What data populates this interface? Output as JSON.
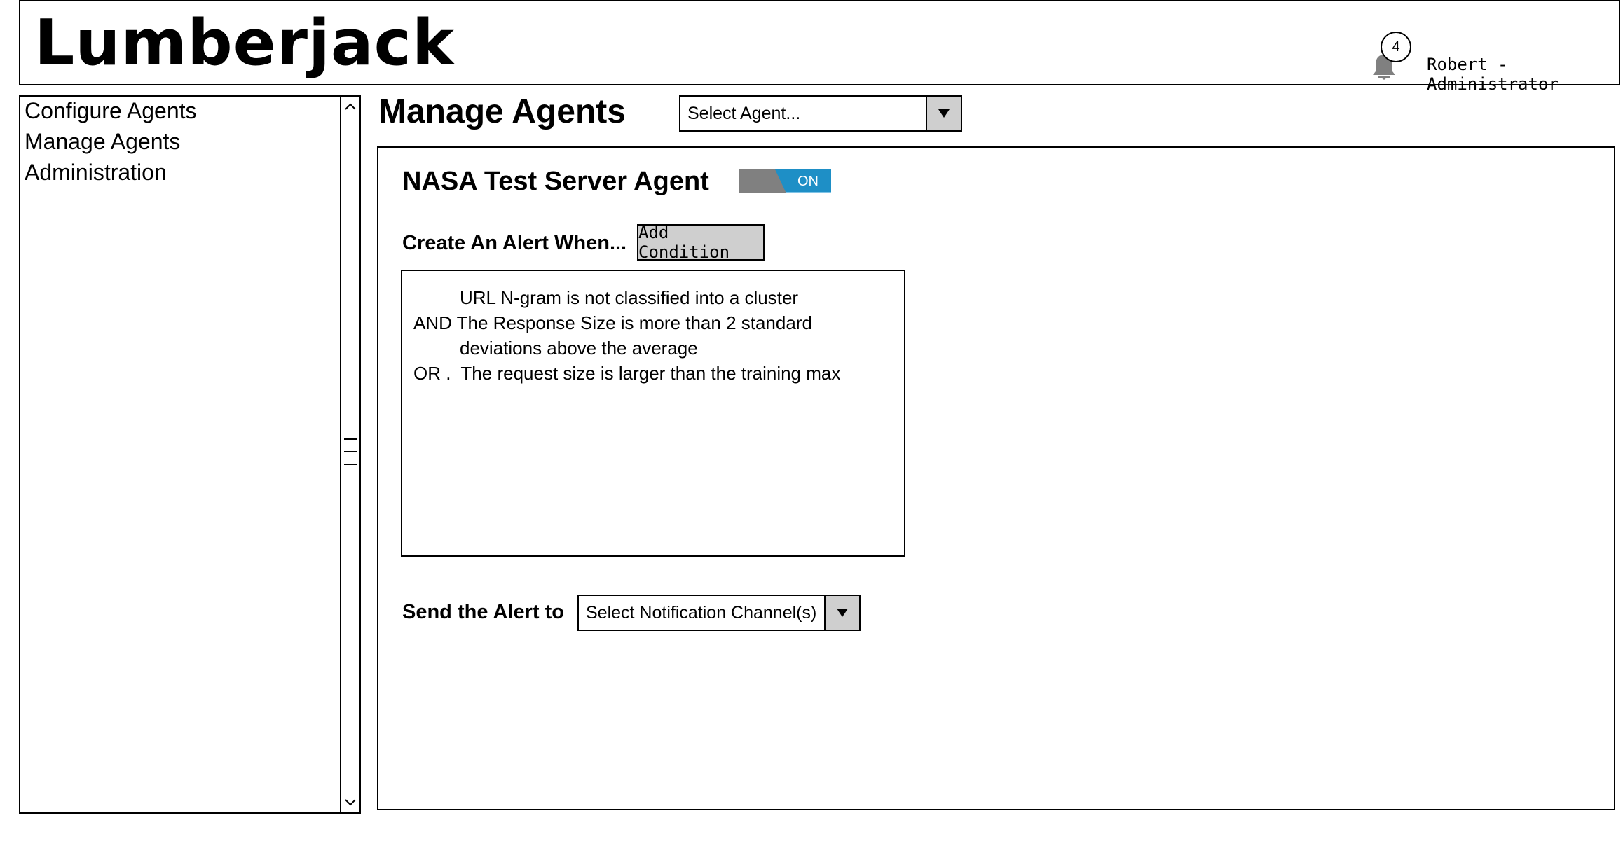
{
  "header": {
    "app_title": "Lumberjack",
    "notification_count": "4",
    "user_label": "Robert - Administrator"
  },
  "sidebar": {
    "items": [
      {
        "label": "Configure Agents"
      },
      {
        "label": "Manage Agents"
      },
      {
        "label": "Administration"
      }
    ]
  },
  "main": {
    "page_title": "Manage Agents",
    "agent_select": {
      "value": "Select Agent..."
    },
    "agent_name": "NASA Test Server Agent",
    "toggle": {
      "label": "ON",
      "state": "on",
      "on_color": "#1e8fc6",
      "off_color": "#808080"
    },
    "alert_when_label": "Create An Alert When...",
    "add_condition_label": "Add Condition",
    "conditions": [
      "URL N-gram is not classified into a cluster",
      "AND The Response Size is more than 2 standard",
      "deviations above the average",
      "OR .  The request size is larger than the training max"
    ],
    "send_to_label": "Send the Alert to",
    "channel_select": {
      "value": "Select Notification Channel(s)"
    }
  }
}
